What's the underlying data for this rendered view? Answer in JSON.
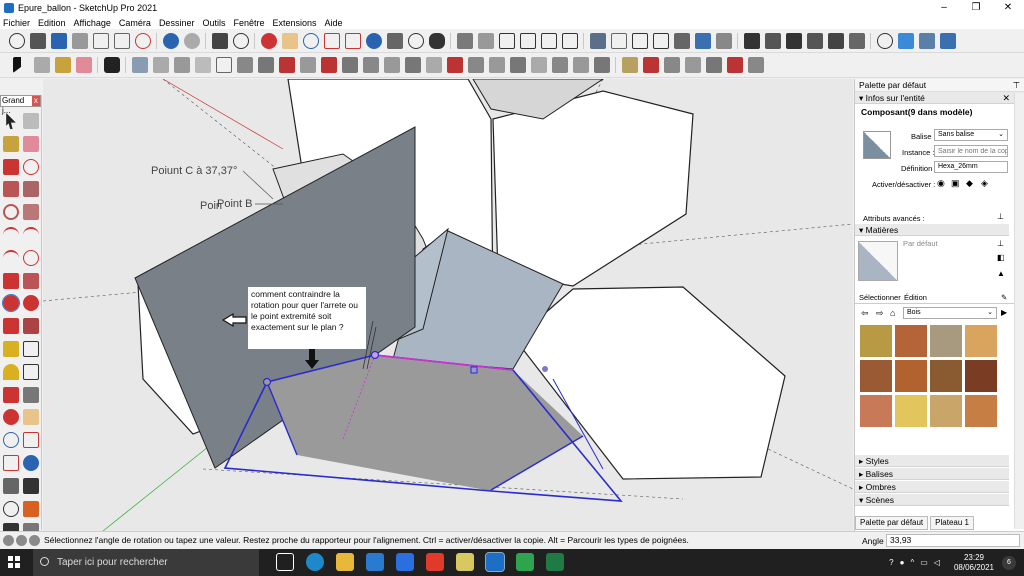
{
  "window": {
    "title": "Epure_ballon - SketchUp Pro 2021",
    "controls": [
      "–",
      "❐",
      "✕"
    ]
  },
  "menu": [
    "Fichier",
    "Edition",
    "Affichage",
    "Caméra",
    "Dessiner",
    "Outils",
    "Fenêtre",
    "Extensions",
    "Aide"
  ],
  "left_palette": {
    "title": "Grand j...",
    "close": "x"
  },
  "viewport": {
    "label_c": "Poiunt C à 37,37°",
    "label_b": "Point B",
    "label_b2": "Poin",
    "annotation": "comment contraindre la rotation pour quer l'arrete ou le point extremité soit exactement sur le plan ?"
  },
  "right_panel": {
    "title": "Palette par défaut",
    "entity_section": "Infos sur l'entité",
    "component_name": "Composant(9 dans modèle)",
    "tag_label": "Balise :",
    "tag_value": "Sans balise",
    "instance_label": "Instance :",
    "instance_placeholder": "Saisir le nom de la copie",
    "definition_label": "Définition :",
    "definition_value": "Hexa_26mm",
    "toggle_label": "Activer/désactiver :",
    "advanced_label": "Attributs avancés :",
    "materials_section": "Matières",
    "material_name": "Par défaut",
    "tab_select": "Sélectionner",
    "tab_edit": "Édition",
    "library": "Bois",
    "sections": [
      "Styles",
      "Balises",
      "Ombres",
      "Scènes"
    ],
    "tray_tabs": [
      "Palette par défaut",
      "Plateau 1"
    ]
  },
  "swatch_colors": [
    "#b99a44",
    "#b5643a",
    "#a79a7e",
    "#d9a45e",
    "#9a5a34",
    "#b2622e",
    "#8a5a30",
    "#7a3c22",
    "#c87a58",
    "#e3c55e",
    "#c9a56a",
    "#c77e44"
  ],
  "status": {
    "message": "Sélectionnez l'angle de rotation ou tapez une valeur.  Restez proche du rapporteur pour l'alignement. Ctrl = activer/désactiver la copie. Alt = Parcourir les types de poignées.",
    "vcb_label": "Angle",
    "vcb_value": "33,93"
  },
  "taskbar": {
    "search_placeholder": "Taper ici pour rechercher",
    "time": "23:29",
    "date": "08/06/2021",
    "notif_count": "6"
  }
}
